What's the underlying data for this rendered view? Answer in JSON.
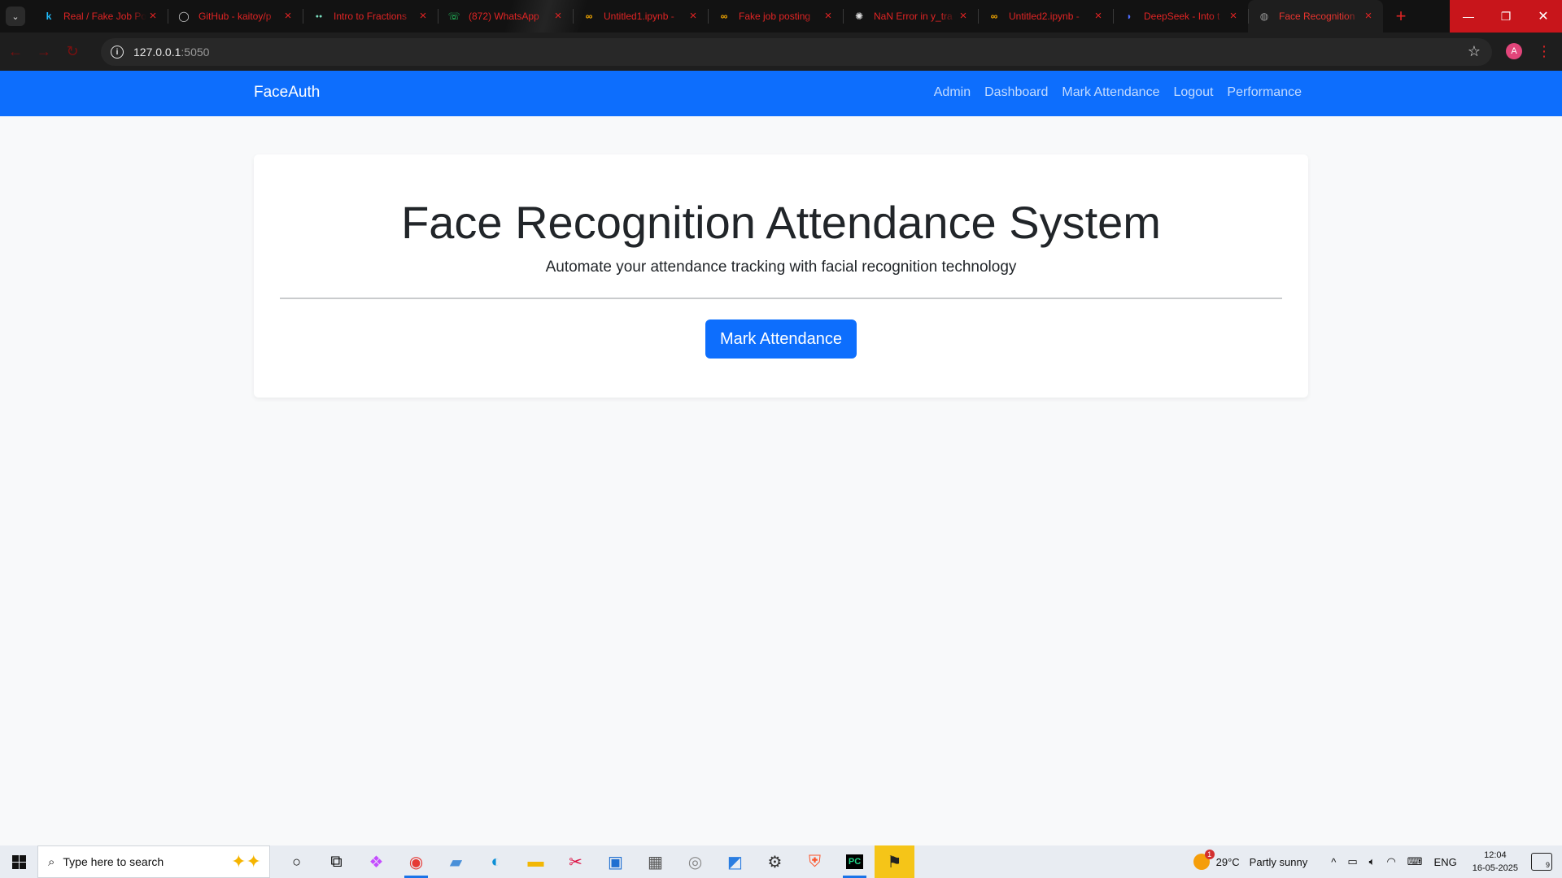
{
  "browser": {
    "tabs": [
      {
        "title": "Real / Fake Job Po",
        "favicon": "kaggle-icon",
        "favicon_glyph": "k",
        "favicon_color": "#20beff",
        "active": false
      },
      {
        "title": "GitHub - kaitoy/p",
        "favicon": "github-icon",
        "favicon_glyph": "◯",
        "favicon_color": "#cfcfcf",
        "active": false
      },
      {
        "title": "Intro to Fractions",
        "favicon": "dots-icon",
        "favicon_glyph": "●●",
        "favicon_color": "#7be0c0",
        "active": false
      },
      {
        "title": "(872) WhatsApp",
        "favicon": "whatsapp-icon",
        "favicon_glyph": "☏",
        "favicon_color": "#25d366",
        "active": false
      },
      {
        "title": "Untitled1.ipynb -",
        "favicon": "colab-icon",
        "favicon_glyph": "∞",
        "favicon_color": "#f9ab00",
        "active": false
      },
      {
        "title": "Fake job posting",
        "favicon": "colab-icon",
        "favicon_glyph": "∞",
        "favicon_color": "#f9ab00",
        "active": false
      },
      {
        "title": "NaN Error in y_tra",
        "favicon": "openai-icon",
        "favicon_glyph": "✺",
        "favicon_color": "#e0e0e0",
        "active": false
      },
      {
        "title": "Untitled2.ipynb -",
        "favicon": "colab-icon",
        "favicon_glyph": "∞",
        "favicon_color": "#f9ab00",
        "active": false
      },
      {
        "title": "DeepSeek - Into t",
        "favicon": "deepseek-icon",
        "favicon_glyph": "◗",
        "favicon_color": "#4d6bfe",
        "active": false
      },
      {
        "title": "Face Recognition",
        "favicon": "globe-icon",
        "favicon_glyph": "◍",
        "favicon_color": "#9a9a9a",
        "active": true
      }
    ],
    "url_host": "127.0.0.1",
    "url_port": ":5050",
    "profile_initial": "A",
    "accent_color": "#e02424"
  },
  "app": {
    "brand": "FaceAuth",
    "nav_links": [
      "Admin",
      "Dashboard",
      "Mark Attendance",
      "Logout",
      "Performance"
    ],
    "primary_color": "#0d6efd"
  },
  "hero": {
    "title": "Face Recognition Attendance System",
    "subtitle": "Automate your attendance tracking with facial recognition technology",
    "button_label": "Mark Attendance"
  },
  "taskbar": {
    "search_placeholder": "Type here to search",
    "weather_temp": "29°C",
    "weather_text": "Partly sunny",
    "weather_badge": "1",
    "language": "ENG",
    "time": "12:04",
    "date": "16-05-2025",
    "notification_count": "9"
  }
}
